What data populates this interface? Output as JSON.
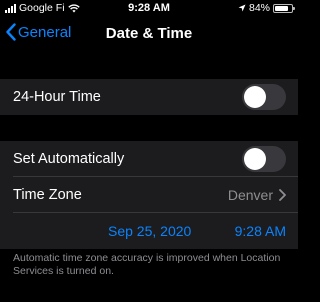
{
  "status_bar": {
    "carrier": "Google Fi",
    "time": "9:28 AM",
    "battery": "84%",
    "battery_level": 0.84
  },
  "nav": {
    "back_label": "General",
    "title": "Date & Time"
  },
  "settings": {
    "hour24": {
      "label": "24-Hour Time",
      "enabled": false
    },
    "set_automatically": {
      "label": "Set Automatically",
      "enabled": false
    },
    "time_zone": {
      "label": "Time Zone",
      "value": "Denver"
    },
    "datetime": {
      "date": "Sep 25, 2020",
      "time": "9:28 AM"
    }
  },
  "footer_note": "Automatic time zone accuracy is improved when Location Services is turned on.",
  "colors": {
    "accent": "#0a84ff",
    "secondary_text": "#8e8e93",
    "cell_bg": "#1c1c1e"
  },
  "icons": [
    "cellular-signal-icon",
    "wifi-icon",
    "location-arrow-icon",
    "battery-icon",
    "chevron-left-icon",
    "chevron-right-icon"
  ]
}
